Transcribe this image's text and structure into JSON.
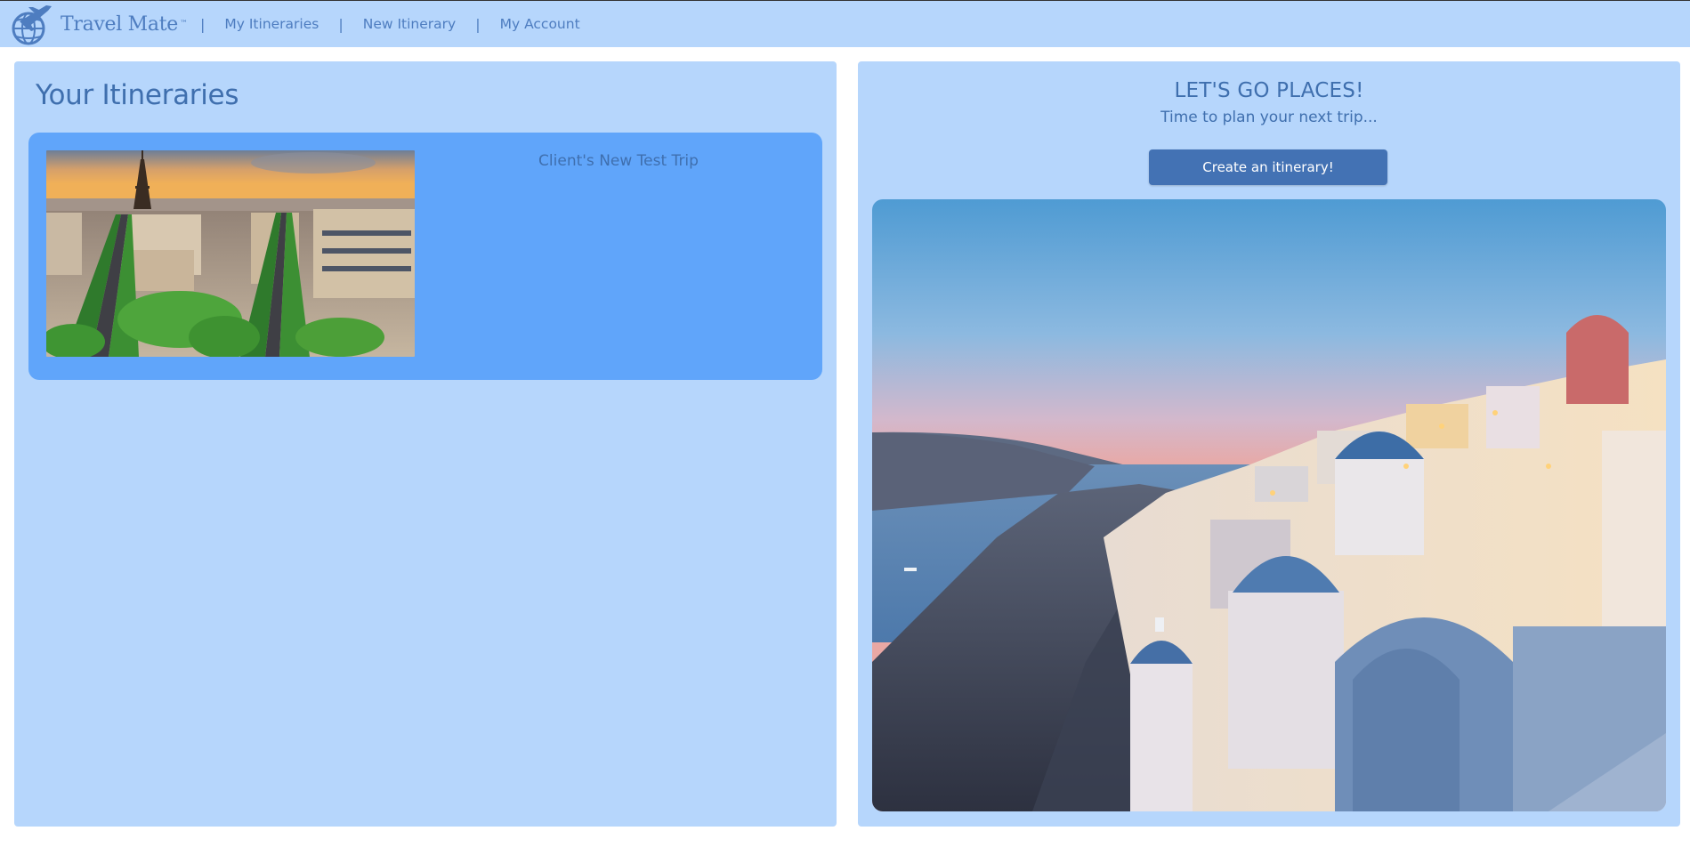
{
  "brand": {
    "name": "Travel Mate",
    "trademark": "™"
  },
  "nav": {
    "separator": "|",
    "links": [
      {
        "label": "My Itineraries"
      },
      {
        "label": "New Itinerary"
      },
      {
        "label": "My Account"
      }
    ]
  },
  "itineraries": {
    "title": "Your Itineraries",
    "items": [
      {
        "name": "Client's New Test Trip",
        "image": "paris-eiffel-tower-photo"
      }
    ]
  },
  "promo": {
    "heading": "LET'S GO PLACES!",
    "subheading": "Time to plan your next trip...",
    "button_label": "Create an itinerary!",
    "image": "santorini-sunset-photo"
  },
  "colors": {
    "nav_bg": "#b6d6fc",
    "panel_bg": "#b6d6fc",
    "card_bg": "#60a5fa",
    "text_blue": "#3f6fae",
    "button_bg": "#4372b4"
  }
}
